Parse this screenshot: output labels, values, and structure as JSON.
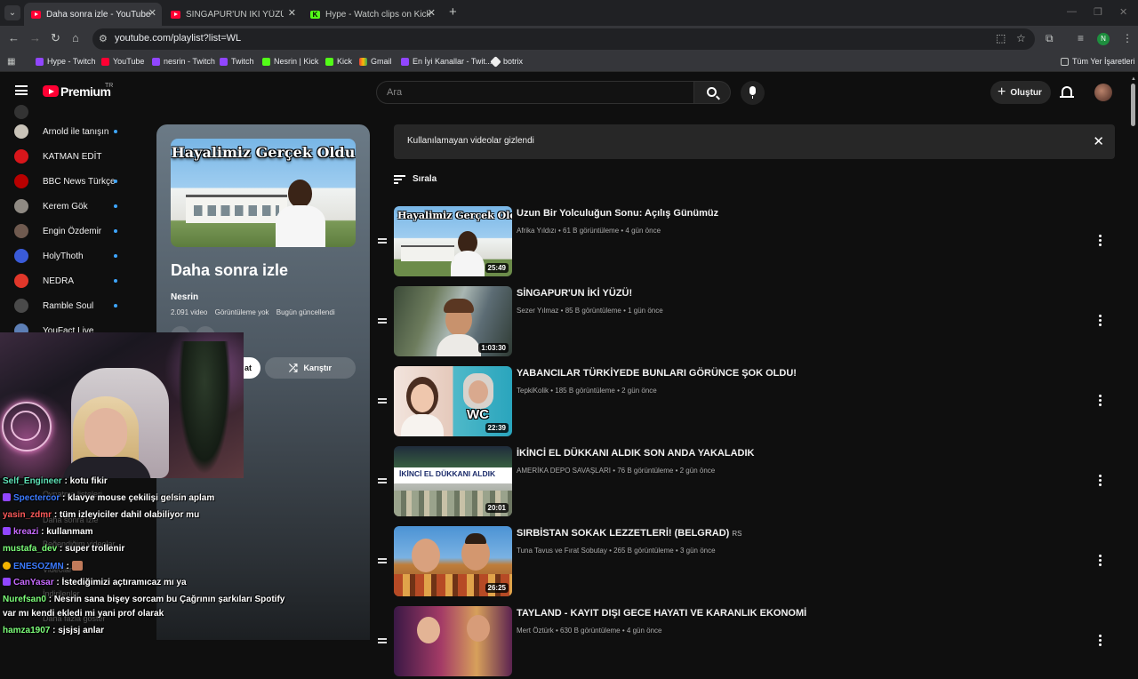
{
  "browser": {
    "tabs": [
      {
        "title": "Daha sonra izle - YouTube",
        "favicon": "youtube-icon",
        "active": true
      },
      {
        "title": "SİNGAPUR'UN İKİ YÜZÜ! - YouTube",
        "favicon": "youtube-icon",
        "active": false
      },
      {
        "title": "Hype - Watch clips on Kick",
        "favicon": "kick-icon",
        "active": false
      }
    ],
    "url": "youtube.com/playlist?list=WL",
    "profile_initial": "N",
    "bookmarks": [
      {
        "label": "Hype - Twitch",
        "icon": "twitch-icon"
      },
      {
        "label": "YouTube",
        "icon": "youtube-icon"
      },
      {
        "label": "nesrin - Twitch",
        "icon": "twitch-icon"
      },
      {
        "label": "Twitch",
        "icon": "twitch-icon"
      },
      {
        "label": "Nesrin | Kick",
        "icon": "kick-icon"
      },
      {
        "label": "Kick",
        "icon": "kick-icon"
      },
      {
        "label": "Gmail",
        "icon": "gmail-icon"
      },
      {
        "label": "En İyi Kanallar - Twit...",
        "icon": "twitch-icon"
      },
      {
        "label": "botrix",
        "icon": "botrix-icon"
      }
    ],
    "all_bookmarks_label": "Tüm Yer İşaretleri"
  },
  "masthead": {
    "logo_text": "Premium",
    "country_code": "TR",
    "search_placeholder": "Ara",
    "create_label": "Oluştur"
  },
  "sidebar": {
    "items": [
      {
        "label": "Arnold ile tanışın",
        "color": "#c9c3b8"
      },
      {
        "label": "KATMAN EDİT",
        "color": "#d8161b"
      },
      {
        "label": "BBC News Türkçe",
        "color": "#b80000"
      },
      {
        "label": "Kerem Gök",
        "color": "#8f8a83"
      },
      {
        "label": "Engin Özdemir",
        "color": "#6f5a4f"
      },
      {
        "label": "HolyThoth",
        "color": "#3a5bd9"
      },
      {
        "label": "NEDRA",
        "color": "#e1372a"
      },
      {
        "label": "Ramble Soul",
        "color": "#4a4a4a"
      },
      {
        "label": "YouFact Live",
        "color": "#5d7fb5"
      }
    ]
  },
  "playlist": {
    "thumb_text": "Hayalimiz Gerçek Oldu",
    "title": "Daha sonra izle",
    "owner": "Nesrin",
    "video_count": "2.091 video",
    "views": "Görüntüleme yok",
    "updated": "Bugün güncellendi",
    "play_label": "at",
    "shuffle_label": "Karıştır"
  },
  "notice": {
    "text": "Kullanılamayan videolar gizlendi"
  },
  "sort_label": "Sırala",
  "videos": [
    {
      "title": "Uzun Bir Yolculuğun Sonu: Açılış Günümüz",
      "channel": "Afrika Yıldızı",
      "views": "61 B görüntüleme",
      "age": "4 gün önce",
      "duration": "25:49",
      "badge": "",
      "thumb_text": "Hayalimiz Gerçek Oldu"
    },
    {
      "title": "SİNGAPUR'UN İKİ YÜZÜ!",
      "channel": "Sezer Yılmaz",
      "views": "85 B görüntüleme",
      "age": "1 gün önce",
      "duration": "1:03:30",
      "badge": "",
      "thumb_text": ""
    },
    {
      "title": "YABANCILAR TÜRKİYEDE BUNLARI GÖRÜNCE ŞOK OLDU!",
      "channel": "TepkiKolik",
      "views": "185 B görüntüleme",
      "age": "2 gün önce",
      "duration": "22:39",
      "badge": "",
      "thumb_text": "WC"
    },
    {
      "title": "İKİNCİ EL DÜKKANI ALDIK SON ANDA YAKALADIK",
      "channel": "AMERİKA DEPO SAVAŞLARI",
      "views": "76 B görüntüleme",
      "age": "2 gün önce",
      "duration": "20:01",
      "badge": "",
      "thumb_text": "İKİNCİ EL DÜKKANI ALDIK"
    },
    {
      "title": "SIRBİSTAN SOKAK LEZZETLERİ! (BELGRAD)",
      "channel": "Tuna Tavus ve Fırat Sobutay",
      "views": "265 B görüntüleme",
      "age": "3 gün önce",
      "duration": "26:25",
      "badge": "RS",
      "thumb_text": ""
    },
    {
      "title": "TAYLAND - KAYIT DIŞI GECE HAYATI VE KARANLIK EKONOMİ",
      "channel": "Mert Öztürk",
      "views": "630 B görüntüleme",
      "age": "4 gün önce",
      "duration": "",
      "badge": "",
      "thumb_text": ""
    }
  ],
  "chat": [
    {
      "user": "Self_Engineer",
      "color": "#5ee0b5",
      "badge": "",
      "text": ": kotu fikir"
    },
    {
      "user": "Spectercor",
      "color": "#3c7bff",
      "badge": "#9146ff",
      "text": ": klavye mouse çekilişi gelsin aplam"
    },
    {
      "user": "yasin_zdmr",
      "color": "#ff5a5a",
      "badge": "",
      "text": ": tüm izleyiciler dahil olabiliyor mu"
    },
    {
      "user": "kreazi",
      "color": "#c86bff",
      "badge": "#9146ff",
      "text": ": kullanmam"
    },
    {
      "user": "mustafa_dev",
      "color": "#7dff7a",
      "badge": "",
      "text": ": super trollenir"
    },
    {
      "user": "ENESOZMN",
      "color": "#3c7bff",
      "badge": "#f4b400",
      "text": ":"
    },
    {
      "user": "CanYasar",
      "color": "#c86bff",
      "badge": "#9146ff",
      "text": ": İstediğimizi açtıramıcaz mı ya"
    },
    {
      "user": "Nurefsan0",
      "color": "#7dff7a",
      "badge": "",
      "text": ": Nesrin sana bişey sorcam bu Çağrının şarkıları Spotify"
    },
    {
      "user": "",
      "color": "#ffffff",
      "badge": "",
      "text": "var mı kendi ekledi mi yani prof olarak"
    },
    {
      "user": "hamza1907",
      "color": "#7dff7a",
      "badge": "",
      "text": ": sjsjsj anlar"
    }
  ],
  "ghost_sidebar": [
    "Oynatma listeleri",
    "Daha sonra izle",
    "Beğendiğim videolar",
    "Videolar",
    "İndirilenler",
    "Daha fazla göster"
  ]
}
